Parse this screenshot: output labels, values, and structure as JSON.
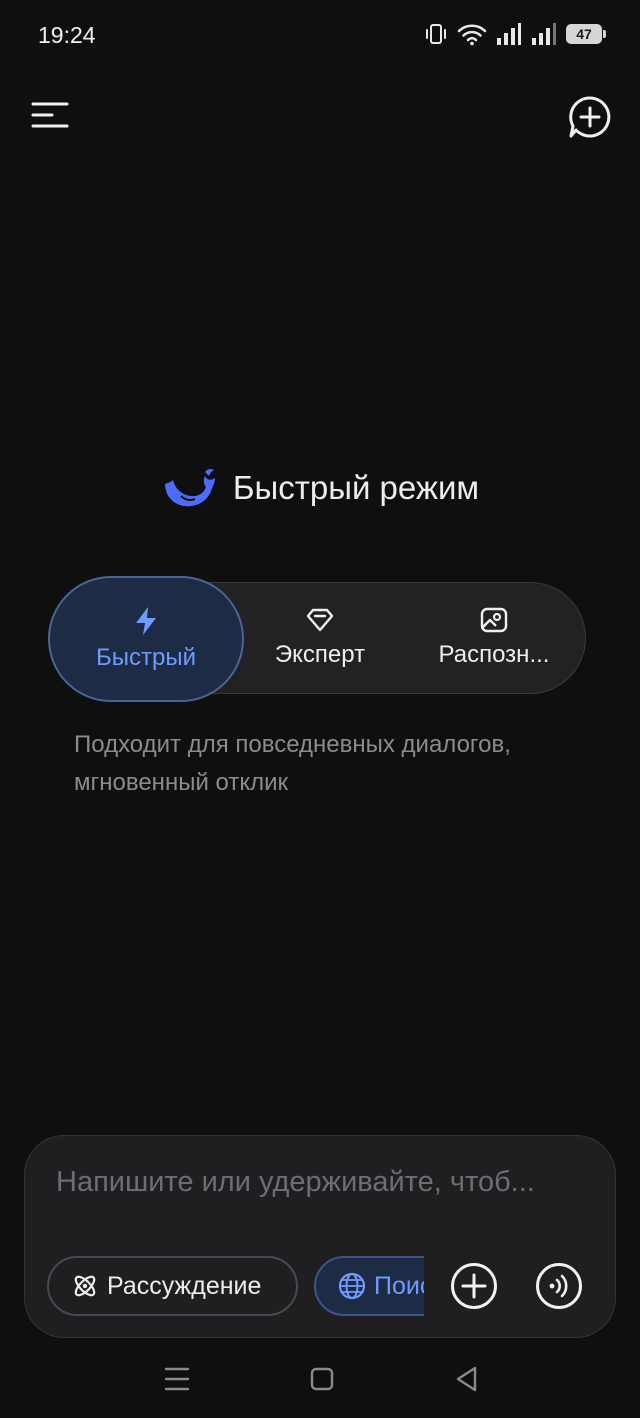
{
  "status": {
    "time": "19:24",
    "battery": "47"
  },
  "title": {
    "text": "Быстрый режим"
  },
  "modes": [
    {
      "label": "Быстрый",
      "icon": "lightning-icon",
      "active": true
    },
    {
      "label": "Эксперт",
      "icon": "diamond-icon",
      "active": false
    },
    {
      "label": "Распозн...",
      "icon": "image-recognition-icon",
      "active": false
    }
  ],
  "mode_description": "Подходит для повседневных диалогов, мгновенный отклик",
  "composer": {
    "placeholder": "Напишите или удерживайте, чтоб...",
    "reasoning_label": "Рассуждение",
    "search_label": "Поиск"
  },
  "colors": {
    "background": "#0f0f10",
    "accent": "#6f9bff",
    "active_fill": "#1e2b44"
  }
}
